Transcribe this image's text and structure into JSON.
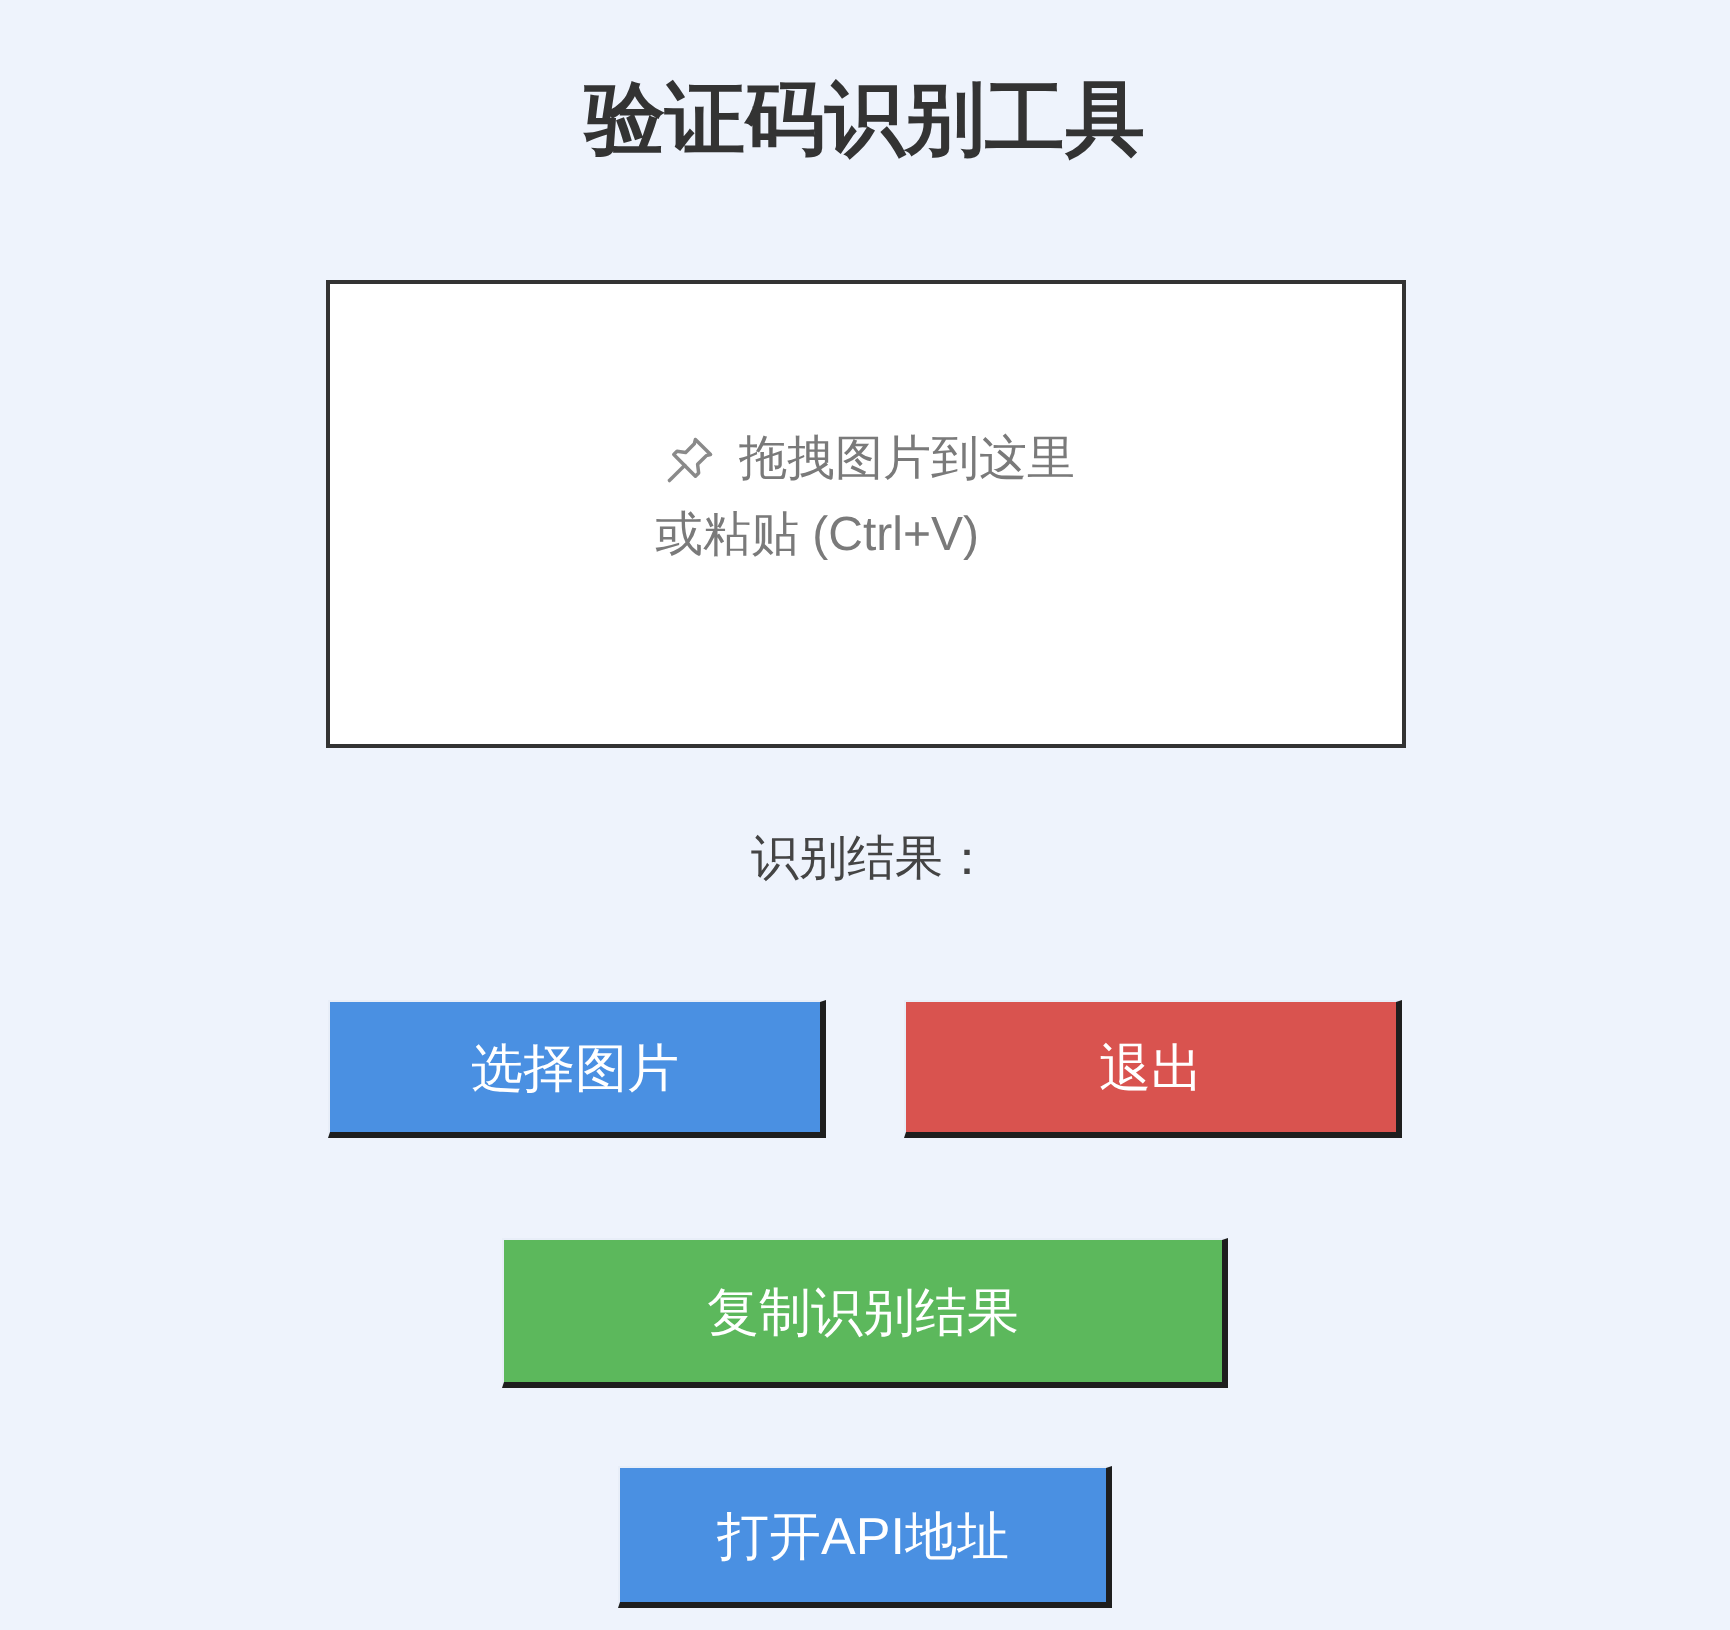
{
  "title": "验证码识别工具",
  "drop_zone": {
    "hint_lines": [
      "拖拽图片到这里",
      "或粘贴 (Ctrl+V)"
    ]
  },
  "result_label": "识别结果：",
  "button_rows": [
    {
      "buttons": [
        {
          "label": "选择图片",
          "color": "#4a90e2"
        },
        {
          "label": "退出",
          "color": "#d9534f"
        }
      ]
    },
    {
      "buttons": [
        {
          "label": "复制识别结果",
          "color": "#5cb85c"
        }
      ]
    },
    {
      "buttons": [
        {
          "label": "打开API地址",
          "color": "#4a90e2"
        }
      ]
    }
  ]
}
